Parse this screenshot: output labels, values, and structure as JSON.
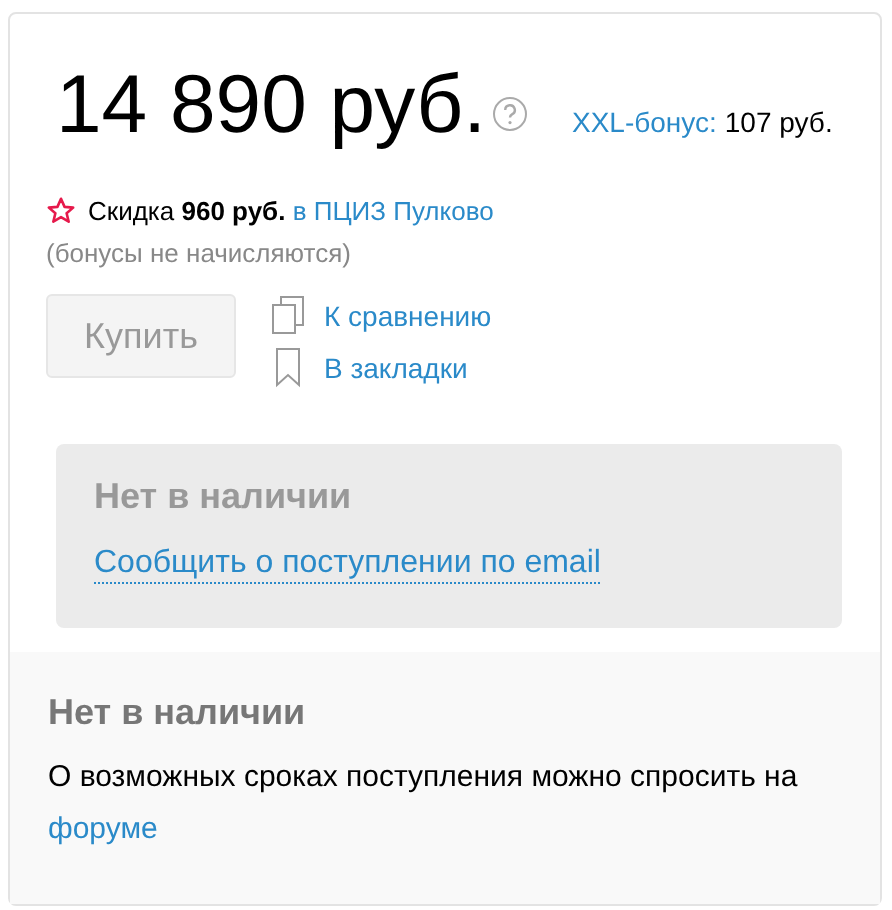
{
  "price": {
    "amount": "14 890 руб.",
    "bonus_label": "XXL-бонус:",
    "bonus_value": "107 руб."
  },
  "discount": {
    "text": "Скидка **960 руб.**",
    "link": "в ПЦИЗ Пулково",
    "note": "(бонусы не начисляются)"
  },
  "buy_button": {
    "label": "Купить",
    "disabled": true
  },
  "actions": [
    {
      "kind": "compare",
      "label": "К сравнению"
    },
    {
      "kind": "bookmark",
      "label": "В закладки"
    }
  ],
  "availability_box": {
    "title": "Нет в наличии",
    "link": "Сообщить о поступлении по email"
  },
  "availability_info": {
    "title": "Нет в наличии",
    "text": "О возможных сроках поступления можно спросить на",
    "link": "форуме"
  }
}
